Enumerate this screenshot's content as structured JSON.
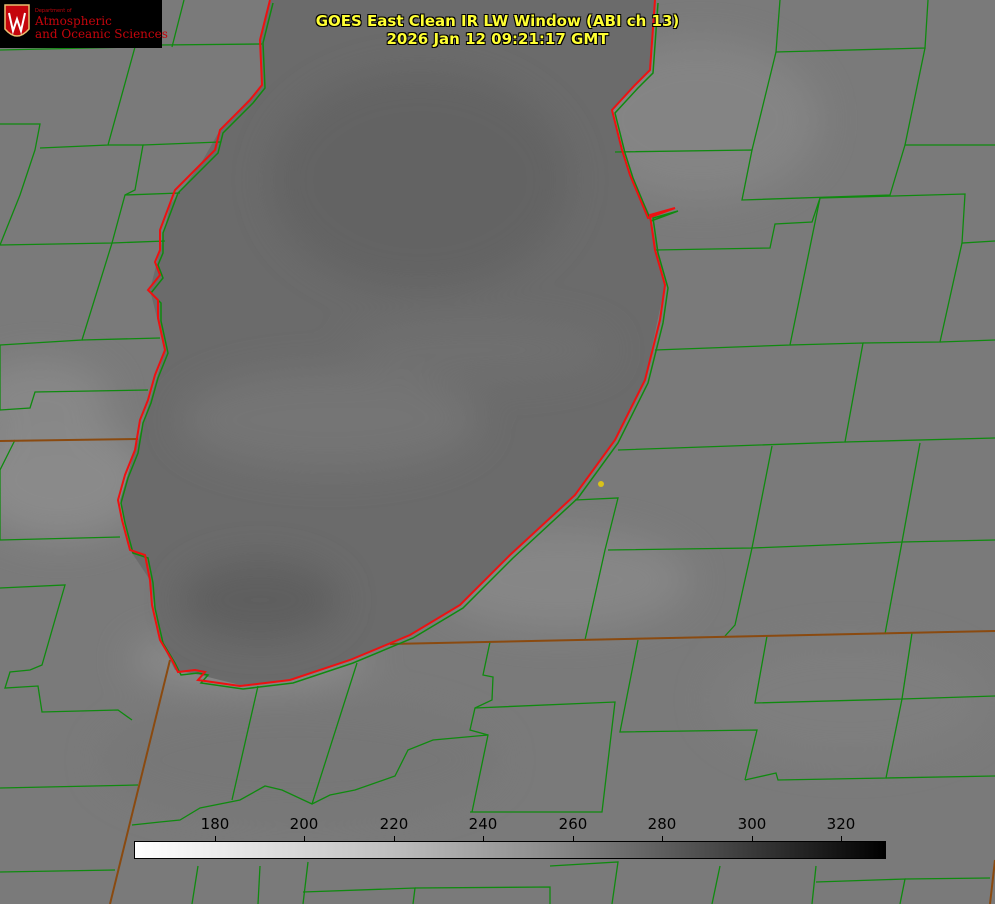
{
  "header": {
    "title_line1": "GOES East Clean IR LW Window (ABI ch 13)",
    "title_line2": "2026 Jan 12 09:21:17 GMT"
  },
  "logo": {
    "department": "Department of",
    "line1": "Atmospheric",
    "line2": "and Oceanic Sciences",
    "crest_letter": "W"
  },
  "colorbar": {
    "ticks": [
      "180",
      "200",
      "220",
      "240",
      "260",
      "280",
      "300",
      "320"
    ],
    "gradient": "white-to-black"
  },
  "colors": {
    "lake_outline": "#ee1111",
    "county_lines": "#0f8a0f",
    "state_line": "#8a4a10",
    "title_text": "#ffff33",
    "station_marker": "#d9c21a"
  }
}
